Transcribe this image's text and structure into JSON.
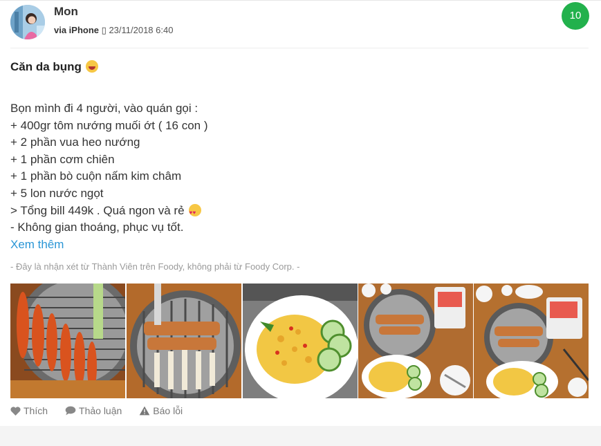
{
  "user": {
    "name": "Mon",
    "via": "via iPhone",
    "via_glyph": "▯",
    "date": "23/11/2018 6:40",
    "score": "10"
  },
  "review": {
    "title": "Căn da bụng",
    "title_emoji": "laughing-face-icon",
    "lines": [
      "Bọn mình đi 4 người, vào quán gọi :",
      "+ 400gr tôm nướng muối ớt ( 16 con )",
      "+ 2 phần vua heo nướng",
      "+ 1 phần cơm chiên",
      "+ 1 phần bò cuộn nấm kim châm",
      "+ 5 lon nước ngọt",
      "> Tổng bill 449k . Quá ngon và rẻ",
      "- Không gian thoáng, phục vụ tốt."
    ],
    "bill_emoji": "heart-eyes-icon",
    "more": "Xem thêm",
    "disclaimer": "- Đây là nhận xét từ Thành Viên trên Foody, không phải từ Foody Corp. -"
  },
  "photos": [
    {
      "subject": "grilled-shrimp-skewers"
    },
    {
      "subject": "grilled-pork-on-grill"
    },
    {
      "subject": "fried-rice-plate"
    },
    {
      "subject": "table-spread-grill-rice"
    },
    {
      "subject": "table-spread-grill-rice-2"
    }
  ],
  "actions": {
    "like": "Thích",
    "discuss": "Thảo luận",
    "report": "Báo lỗi"
  },
  "colors": {
    "score_bg": "#22b14c",
    "link": "#2a96d6",
    "muted": "#9a9a9a"
  }
}
